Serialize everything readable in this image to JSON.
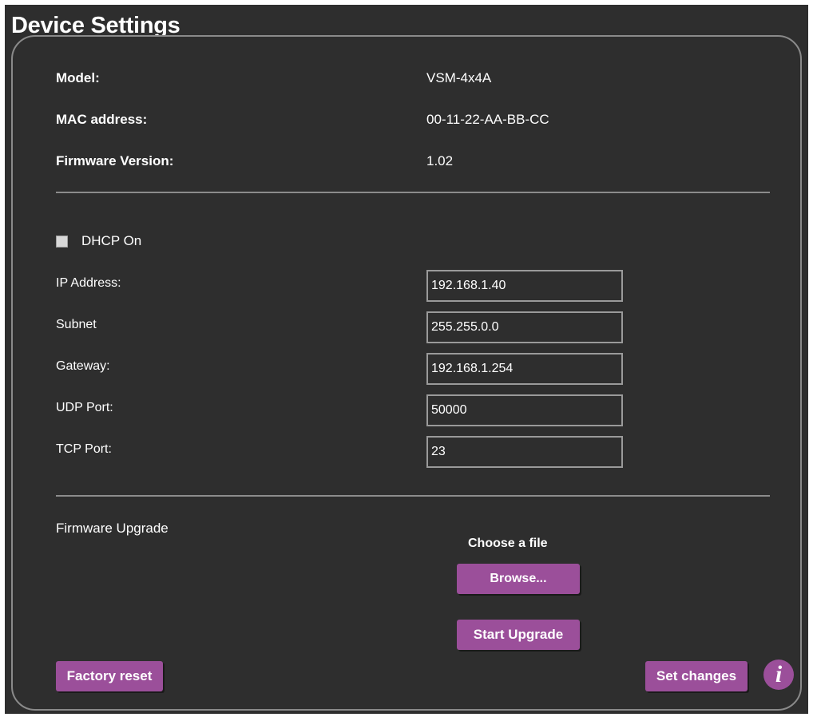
{
  "page": {
    "title": "Device Settings"
  },
  "info": {
    "model_label": "Model:",
    "model_value": "VSM-4x4A",
    "mac_label": "MAC address:",
    "mac_value": "00-11-22-AA-BB-CC",
    "firmware_label": "Firmware Version:",
    "firmware_value": "1.02"
  },
  "network": {
    "dhcp_label": "DHCP On",
    "dhcp_checked": false,
    "ip_label": "IP Address:",
    "ip_value": "192.168.1.40",
    "subnet_label": "Subnet",
    "subnet_value": "255.255.0.0",
    "gateway_label": "Gateway:",
    "gateway_value": "192.168.1.254",
    "udp_label": "UDP Port:",
    "udp_value": "50000",
    "tcp_label": "TCP Port:",
    "tcp_value": "23"
  },
  "firmware_upgrade": {
    "label": "Firmware Upgrade",
    "choose_label": "Choose a file",
    "browse_label": "Browse...",
    "start_label": "Start Upgrade"
  },
  "actions": {
    "factory_reset_label": "Factory reset",
    "set_changes_label": "Set changes",
    "info_icon": "info-icon"
  },
  "colors": {
    "background": "#2e2e2e",
    "accent": "#9b4f9a",
    "text": "#ffffff"
  }
}
